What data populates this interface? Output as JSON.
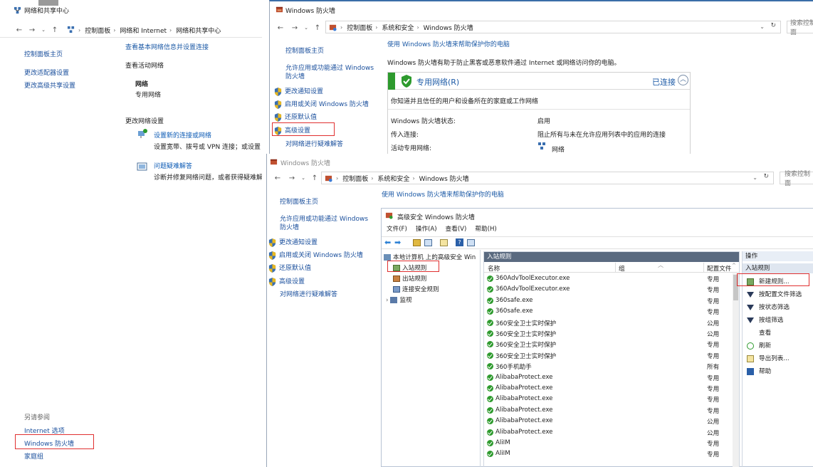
{
  "win1": {
    "title": "网络和共享中心",
    "breadcrumb": [
      "控制面板",
      "网络和 Internet",
      "网络和共享中心"
    ],
    "sidebar": [
      "控制面板主页",
      "更改适配器设置",
      "更改高级共享设置"
    ],
    "main_title": "查看基本网络信息并设置连接",
    "active_networks": "查看活动网络",
    "network_name": "网络",
    "network_type": "专用网络",
    "change_settings": "更改网络设置",
    "task1_link": "设置新的连接或网络",
    "task1_desc": "设置宽带、拨号或 VPN 连接；或设置",
    "task2_link": "问题疑难解答",
    "task2_desc": "诊断并修复网络问题，或者获得疑难解",
    "see_also": "另请参阅",
    "see_also_items": [
      "Internet 选项",
      "Windows 防火墙",
      "家庭组"
    ]
  },
  "win2": {
    "title": "Windows 防火墙",
    "breadcrumb": [
      "控制面板",
      "系统和安全",
      "Windows 防火墙"
    ],
    "search_placeholder": "搜索控制面",
    "sidebar": [
      "控制面板主页",
      "允许应用或功能通过 Windows 防火墙",
      "更改通知设置",
      "启用或关闭 Windows 防火墙",
      "还原默认值",
      "高级设置",
      "对网络进行疑难解答"
    ],
    "main_title": "使用 Windows 防火墙来帮助保护你的电脑",
    "desc": "Windows 防火墙有助于防止黑客或恶意软件通过 Internet 或网络访问你的电脑。",
    "private_network": "专用网络(R)",
    "connected": "已连接",
    "private_desc": "你知道并且信任的用户和设备所在的家庭或工作网络",
    "rows": [
      {
        "label": "Windows 防火墙状态:",
        "value": "启用"
      },
      {
        "label": "传入连接:",
        "value": "阻止所有与未在允许应用列表中的应用的连接"
      },
      {
        "label": "活动专用网络:",
        "value": "网络"
      }
    ]
  },
  "win3": {
    "title": "Windows 防火墙",
    "breadcrumb": [
      "控制面板",
      "系统和安全",
      "Windows 防火墙"
    ],
    "search_placeholder": "搜索控制面",
    "sidebar": [
      "控制面板主页",
      "允许应用或功能通过 Windows 防火墙",
      "更改通知设置",
      "启用或关闭 Windows 防火墙",
      "还原默认值",
      "高级设置",
      "对网络进行疑难解答"
    ],
    "main_title": "使用 Windows 防火墙来帮助保护你的电脑"
  },
  "adv": {
    "title": "高级安全 Windows 防火墙",
    "menu": [
      "文件(F)",
      "操作(A)",
      "查看(V)",
      "帮助(H)"
    ],
    "tree_root": "本地计算机 上的高级安全 Win",
    "tree_items": [
      "入站规则",
      "出站规则",
      "连接安全规则",
      "监视"
    ],
    "center_header": "入站规则",
    "columns": [
      "名称",
      "组",
      "配置文件"
    ],
    "rules": [
      {
        "name": "360AdvToolExecutor.exe",
        "profile": "专用"
      },
      {
        "name": "360AdvToolExecutor.exe",
        "profile": "专用"
      },
      {
        "name": "360safe.exe",
        "profile": "专用"
      },
      {
        "name": "360safe.exe",
        "profile": "专用"
      },
      {
        "name": "360安全卫士实时保护",
        "profile": "公用"
      },
      {
        "name": "360安全卫士实时保护",
        "profile": "公用"
      },
      {
        "name": "360安全卫士实时保护",
        "profile": "专用"
      },
      {
        "name": "360安全卫士实时保护",
        "profile": "专用"
      },
      {
        "name": "360手机助手",
        "profile": "所有"
      },
      {
        "name": "AlibabaProtect.exe",
        "profile": "专用"
      },
      {
        "name": "AlibabaProtect.exe",
        "profile": "专用"
      },
      {
        "name": "AlibabaProtect.exe",
        "profile": "专用"
      },
      {
        "name": "AlibabaProtect.exe",
        "profile": "专用"
      },
      {
        "name": "AlibabaProtect.exe",
        "profile": "公用"
      },
      {
        "name": "AlibabaProtect.exe",
        "profile": "公用"
      },
      {
        "name": "AliIM",
        "profile": "专用"
      },
      {
        "name": "AliIM",
        "profile": "专用"
      }
    ],
    "actions_header": "操作",
    "actions_sub": "入站规则",
    "actions": [
      "新建规则...",
      "按配置文件筛选",
      "按状态筛选",
      "按组筛选",
      "查看",
      "刷新",
      "导出列表...",
      "帮助"
    ]
  },
  "colors": {
    "accent_red": "#e03030",
    "link": "#1a4f9c",
    "green": "#2d9a2d"
  }
}
